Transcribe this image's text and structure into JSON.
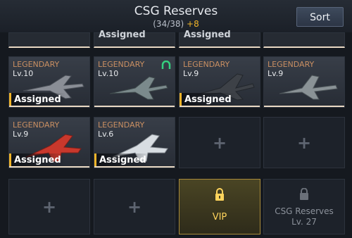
{
  "header": {
    "title": "CSG Reserves",
    "count": "(34/38)",
    "bonus": "+8",
    "sort_label": "Sort"
  },
  "top_partial_row": [
    {
      "label": ""
    },
    {
      "label": "Assigned"
    },
    {
      "label": "Assigned"
    },
    {
      "label": ""
    }
  ],
  "slots": [
    {
      "rarity": "LEGENDARY",
      "level": "Lv.10",
      "status": "Assigned",
      "tag": false,
      "jet_color": "#8a8e96"
    },
    {
      "rarity": "LEGENDARY",
      "level": "Lv.10",
      "status": "",
      "tag": true,
      "jet_color": "#7b8a8c"
    },
    {
      "rarity": "LEGENDARY",
      "level": "Lv.9",
      "status": "Assigned",
      "tag": false,
      "jet_color": "#3d4147"
    },
    {
      "rarity": "LEGENDARY",
      "level": "Lv.9",
      "status": "",
      "tag": false,
      "jet_color": "#8a9296"
    },
    {
      "rarity": "LEGENDARY",
      "level": "Lv.9",
      "status": "Assigned",
      "tag": false,
      "jet_color": "#c8382c"
    },
    {
      "rarity": "LEGENDARY",
      "level": "Lv.6",
      "status": "Assigned",
      "tag": false,
      "jet_color": "#d8dde2"
    }
  ],
  "locked": {
    "vip_label": "VIP",
    "csg_label": "CSG Reserves",
    "csg_level": "Lv. 27"
  },
  "colors": {
    "rarity": "#c98f62",
    "assigned_accent": "#f0b429",
    "vip_gold": "#ffd45c"
  }
}
